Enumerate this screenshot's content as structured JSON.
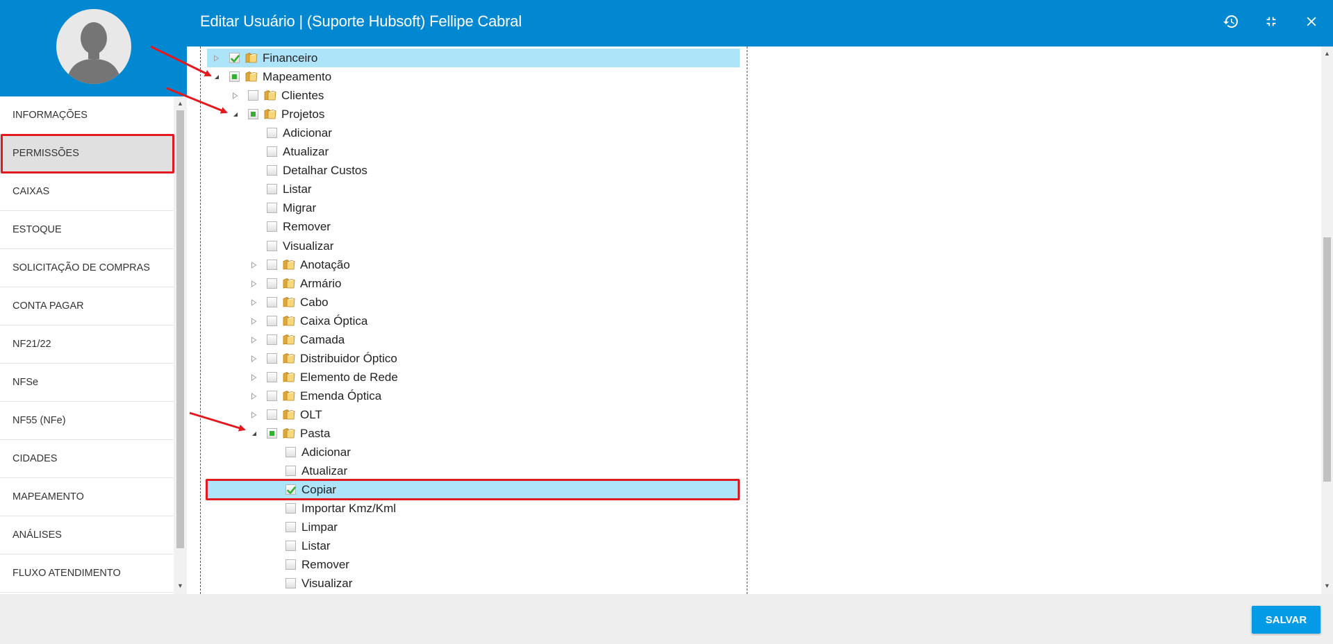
{
  "window": {
    "title": "Editar Usuário | (Suporte Hubsoft) Fellipe Cabral",
    "icons": [
      "history-icon",
      "compress-icon",
      "close-icon"
    ]
  },
  "user": {
    "avatar_icon": "user-placeholder-icon"
  },
  "nav": {
    "items": [
      {
        "label": "INFORMAÇÕES",
        "active": false
      },
      {
        "label": "PERMISSÕES",
        "active": true
      },
      {
        "label": "CAIXAS",
        "active": false
      },
      {
        "label": "ESTOQUE",
        "active": false
      },
      {
        "label": "SOLICITAÇÃO DE COMPRAS",
        "active": false
      },
      {
        "label": "CONTA PAGAR",
        "active": false
      },
      {
        "label": "NF21/22",
        "active": false
      },
      {
        "label": "NFSe",
        "active": false
      },
      {
        "label": "NF55 (NFe)",
        "active": false
      },
      {
        "label": "CIDADES",
        "active": false
      },
      {
        "label": "MAPEAMENTO",
        "active": false
      },
      {
        "label": "ANÁLISES",
        "active": false
      },
      {
        "label": "FLUXO ATENDIMENTO",
        "active": false
      }
    ]
  },
  "tree": {
    "rows": [
      {
        "label": "Financeiro",
        "level": 0,
        "expander": "collapsed",
        "check": "checked",
        "folder": true,
        "selected": true
      },
      {
        "label": "Mapeamento",
        "level": 0,
        "expander": "expanded",
        "check": "partial",
        "folder": true,
        "selected": false
      },
      {
        "label": "Clientes",
        "level": 1,
        "expander": "collapsed",
        "check": "unchecked",
        "folder": true,
        "selected": false
      },
      {
        "label": "Projetos",
        "level": 1,
        "expander": "expanded",
        "check": "partial",
        "folder": true,
        "selected": false
      },
      {
        "label": "Adicionar",
        "level": 2,
        "expander": "none",
        "check": "unchecked",
        "folder": false,
        "selected": false
      },
      {
        "label": "Atualizar",
        "level": 2,
        "expander": "none",
        "check": "unchecked",
        "folder": false,
        "selected": false
      },
      {
        "label": "Detalhar Custos",
        "level": 2,
        "expander": "none",
        "check": "unchecked",
        "folder": false,
        "selected": false
      },
      {
        "label": "Listar",
        "level": 2,
        "expander": "none",
        "check": "unchecked",
        "folder": false,
        "selected": false
      },
      {
        "label": "Migrar",
        "level": 2,
        "expander": "none",
        "check": "unchecked",
        "folder": false,
        "selected": false
      },
      {
        "label": "Remover",
        "level": 2,
        "expander": "none",
        "check": "unchecked",
        "folder": false,
        "selected": false
      },
      {
        "label": "Visualizar",
        "level": 2,
        "expander": "none",
        "check": "unchecked",
        "folder": false,
        "selected": false
      },
      {
        "label": "Anotação",
        "level": 2,
        "expander": "collapsed",
        "check": "unchecked",
        "folder": true,
        "selected": false
      },
      {
        "label": "Armário",
        "level": 2,
        "expander": "collapsed",
        "check": "unchecked",
        "folder": true,
        "selected": false
      },
      {
        "label": "Cabo",
        "level": 2,
        "expander": "collapsed",
        "check": "unchecked",
        "folder": true,
        "selected": false
      },
      {
        "label": "Caixa Óptica",
        "level": 2,
        "expander": "collapsed",
        "check": "unchecked",
        "folder": true,
        "selected": false
      },
      {
        "label": "Camada",
        "level": 2,
        "expander": "collapsed",
        "check": "unchecked",
        "folder": true,
        "selected": false
      },
      {
        "label": "Distribuidor Óptico",
        "level": 2,
        "expander": "collapsed",
        "check": "unchecked",
        "folder": true,
        "selected": false
      },
      {
        "label": "Elemento de Rede",
        "level": 2,
        "expander": "collapsed",
        "check": "unchecked",
        "folder": true,
        "selected": false
      },
      {
        "label": "Emenda Óptica",
        "level": 2,
        "expander": "collapsed",
        "check": "unchecked",
        "folder": true,
        "selected": false
      },
      {
        "label": "OLT",
        "level": 2,
        "expander": "collapsed",
        "check": "unchecked",
        "folder": true,
        "selected": false
      },
      {
        "label": "Pasta",
        "level": 2,
        "expander": "expanded",
        "check": "partial",
        "folder": true,
        "selected": false
      },
      {
        "label": "Adicionar",
        "level": 3,
        "expander": "none",
        "check": "unchecked",
        "folder": false,
        "selected": false
      },
      {
        "label": "Atualizar",
        "level": 3,
        "expander": "none",
        "check": "unchecked",
        "folder": false,
        "selected": false
      },
      {
        "label": "Copiar",
        "level": 3,
        "expander": "none",
        "check": "checked",
        "folder": false,
        "selected": true
      },
      {
        "label": "Importar Kmz/Kml",
        "level": 3,
        "expander": "none",
        "check": "unchecked",
        "folder": false,
        "selected": false
      },
      {
        "label": "Limpar",
        "level": 3,
        "expander": "none",
        "check": "unchecked",
        "folder": false,
        "selected": false
      },
      {
        "label": "Listar",
        "level": 3,
        "expander": "none",
        "check": "unchecked",
        "folder": false,
        "selected": false
      },
      {
        "label": "Remover",
        "level": 3,
        "expander": "none",
        "check": "unchecked",
        "folder": false,
        "selected": false
      },
      {
        "label": "Visualizar",
        "level": 3,
        "expander": "none",
        "check": "unchecked",
        "folder": false,
        "selected": false
      }
    ]
  },
  "footer": {
    "save_label": "SALVAR"
  },
  "colors": {
    "header": "#0288d1",
    "save_button": "#039be5",
    "selected_row": "#aee4f9",
    "annotation": "#e2191e",
    "check_green": "#35b035"
  }
}
